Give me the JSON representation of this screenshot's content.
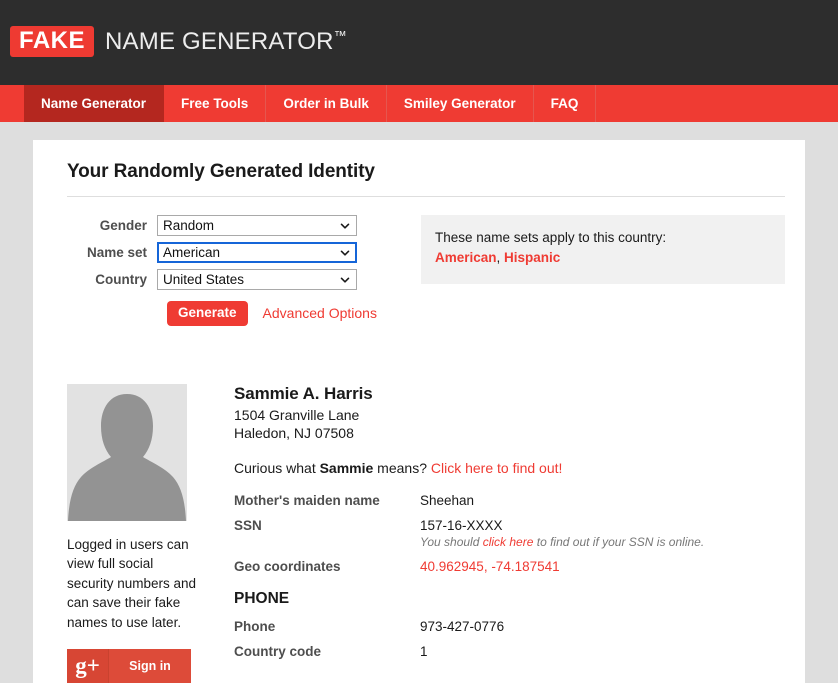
{
  "header": {
    "badge": "FAKE",
    "title": "NAME GENERATOR",
    "tm": "™"
  },
  "nav": {
    "items": [
      {
        "label": "Name Generator",
        "active": true
      },
      {
        "label": "Free Tools",
        "active": false
      },
      {
        "label": "Order in Bulk",
        "active": false
      },
      {
        "label": "Smiley Generator",
        "active": false
      },
      {
        "label": "FAQ",
        "active": false
      }
    ]
  },
  "card": {
    "title": "Your Randomly Generated Identity"
  },
  "form": {
    "gender": {
      "label": "Gender",
      "value": "Random",
      "focused": false
    },
    "nameset": {
      "label": "Name set",
      "value": "American",
      "focused": true
    },
    "country": {
      "label": "Country",
      "value": "United States",
      "focused": false
    },
    "generate_label": "Generate",
    "advanced_label": "Advanced Options"
  },
  "infobox": {
    "intro": "These name sets apply to this country:",
    "sets": [
      "American",
      "Hispanic"
    ],
    "separator": ", "
  },
  "sidebar": {
    "avatar_alt": "person-silhouette",
    "note": "Logged in users can view full social security numbers and can save their fake names to use later.",
    "signin": {
      "icon": "g+",
      "label": "Sign in"
    }
  },
  "identity": {
    "name": "Sammie A. Harris",
    "street": "1504 Granville Lane",
    "citystatezip": "Haledon, NJ 07508",
    "curious_prefix": "Curious what ",
    "curious_name": "Sammie",
    "curious_suffix": " means? ",
    "curious_link": "Click here to find out!",
    "rows": [
      {
        "label": "Mother's maiden name",
        "value": "Sheehan",
        "red": false
      },
      {
        "label": "SSN",
        "value": "157-16-XXXX",
        "red": false,
        "note_prefix": "You should ",
        "note_link": "click here",
        "note_suffix": " to find out if your SSN is online."
      },
      {
        "label": "Geo coordinates",
        "value": "40.962945, -74.187541",
        "red": true
      }
    ],
    "phone_section": "PHONE",
    "phone_rows": [
      {
        "label": "Phone",
        "value": "973-427-0776"
      },
      {
        "label": "Country code",
        "value": "1"
      }
    ]
  },
  "colors": {
    "brand_red": "#ef3b33",
    "nav_active": "#b4271f",
    "header_dark": "#2d2d2d",
    "page_bg": "#dedede",
    "infobox_bg": "#f1f1f1",
    "gplus": "#dd4b39"
  }
}
